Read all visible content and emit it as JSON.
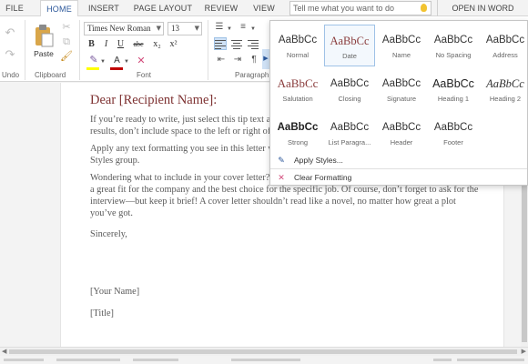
{
  "tabs": [
    "FILE",
    "HOME",
    "INSERT",
    "PAGE LAYOUT",
    "REVIEW",
    "VIEW"
  ],
  "active_tab": "HOME",
  "tell_me": {
    "placeholder": "Tell me what you want to do"
  },
  "open_in_word": "OPEN IN WORD",
  "ribbon": {
    "groups": {
      "undo": "Undo",
      "clipboard": "Clipboard",
      "font": "Font",
      "paragraph": "Paragraph"
    },
    "paste_label": "Paste",
    "font_name": "Times New Roman",
    "font_size": "13",
    "format_buttons": {
      "bold": "B",
      "italic": "I",
      "underline": "U",
      "strike": "abc",
      "subscript": "x₂",
      "superscript": "x²",
      "font_color": "A"
    }
  },
  "document": {
    "greeting": "Dear [Recipient Name]:",
    "paragraphs": [
      "If you’re ready to write, just select this tip text and start typing to replace it with your own. For best results, don’t include space to the left or right of the characters in your selection.",
      "Apply any text formatting you see in this letter with just a click from the Home tab of the ribbon, in the Styles group.",
      "Wondering what to include in your cover letter? It’s a good idea to include key points about why you’re a great fit for the company and the best choice for the specific job. Of course, don’t forget to ask for the interview—but keep it brief! A cover letter shouldn’t read like a novel, no matter how great a plot you’ve got."
    ],
    "closing": "Sincerely,",
    "signature_name": "[Your Name]",
    "signature_title": "[Title]"
  },
  "styles_gallery": {
    "items": [
      {
        "sample": "AaBbCc",
        "name": "Normal"
      },
      {
        "sample": "AaBbCc",
        "name": "Date",
        "selected": true
      },
      {
        "sample": "AaBbCc",
        "name": "Name"
      },
      {
        "sample": "AaBbCc",
        "name": "No Spacing"
      },
      {
        "sample": "AaBbCc",
        "name": "Address"
      },
      {
        "sample": "AaBbCc",
        "name": "Salutation"
      },
      {
        "sample": "AaBbCc",
        "name": "Closing"
      },
      {
        "sample": "AaBbCc",
        "name": "Signature"
      },
      {
        "sample": "AaBbCc",
        "name": "Heading 1"
      },
      {
        "sample": "AaBbCc",
        "name": "Heading 2"
      },
      {
        "sample": "AaBbCc",
        "name": "Strong"
      },
      {
        "sample": "AaBbCc",
        "name": "List Paragra..."
      },
      {
        "sample": "AaBbCc",
        "name": "Header"
      },
      {
        "sample": "AaBbCc",
        "name": "Footer"
      }
    ],
    "apply_styles": "Apply Styles...",
    "clear_formatting": "Clear Formatting"
  },
  "colors": {
    "accent": "#2b579a",
    "greeting": "#7e3232",
    "highlight": "#ffff00",
    "font_color": "#c00000",
    "selected_style_border": "#9fc2e6"
  }
}
